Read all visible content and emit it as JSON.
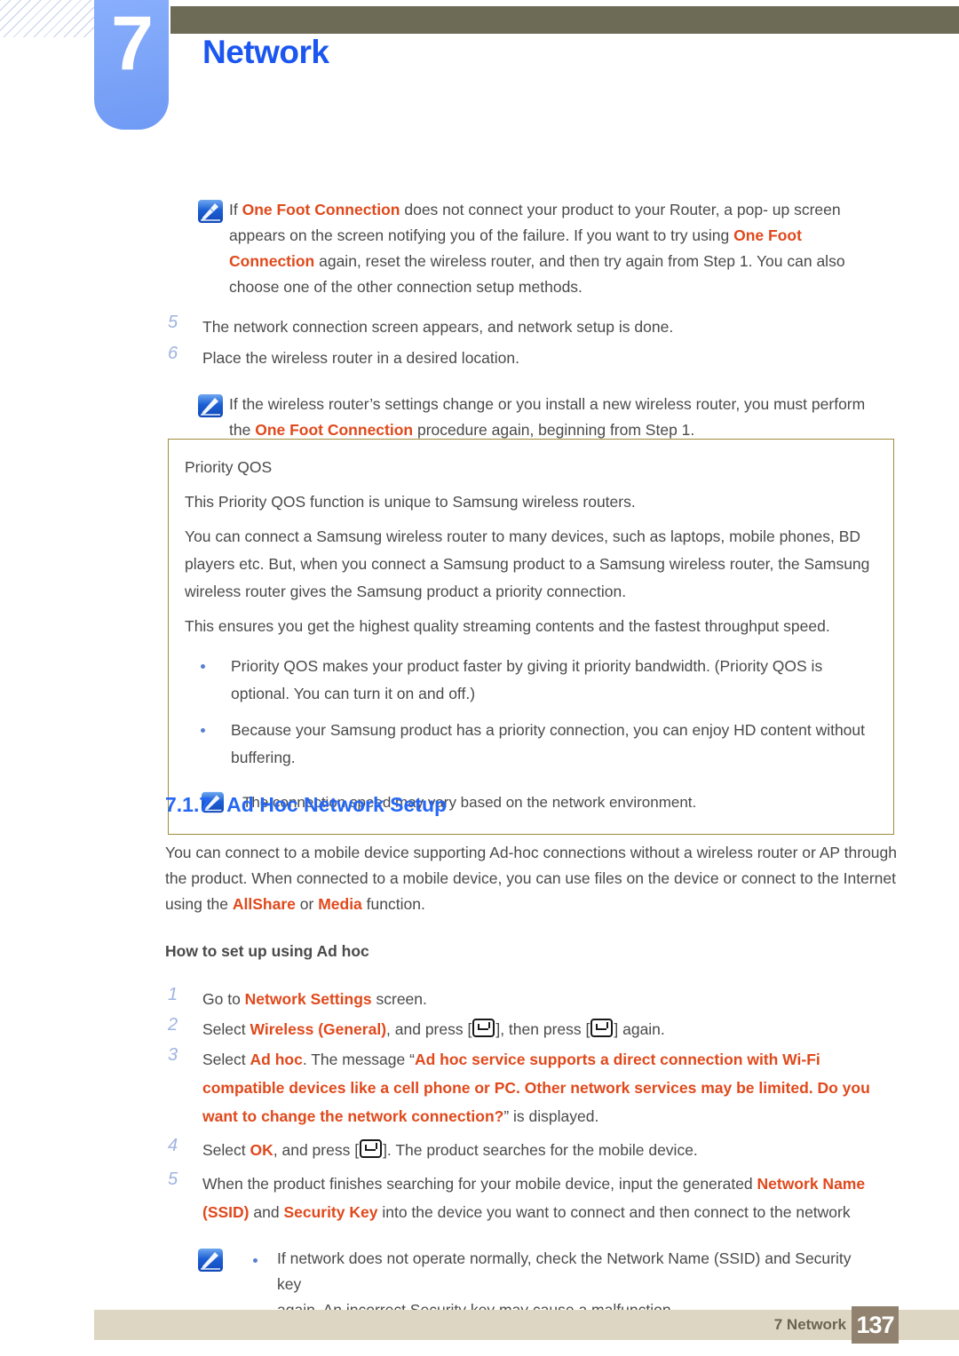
{
  "header": {
    "chapter_number": "7",
    "chapter_title": "Network"
  },
  "notes": {
    "note1": {
      "icon": "note-pencil-icon",
      "text_runs": [
        {
          "t": "If ",
          "style": "normal"
        },
        {
          "t": "One Foot Connection",
          "style": "highlight"
        },
        {
          "t": " does not connect your product to your Router, a pop- up screen appears on the screen notifying you of the failure. If you want to try using ",
          "style": "normal"
        },
        {
          "t": "One Foot Connection",
          "style": "highlight"
        },
        {
          "t": " again, reset the wireless router, and then try again from Step 1. You can also choose one of the other connection setup methods.",
          "style": "normal"
        }
      ]
    },
    "note2": {
      "icon": "note-pencil-icon",
      "text_runs": [
        {
          "t": "If the wireless router’s settings change or you install a new wireless router, you must perform the ",
          "style": "normal"
        },
        {
          "t": "One Foot Connection",
          "style": "highlight"
        },
        {
          "t": " procedure again, beginning from Step 1.",
          "style": "normal"
        }
      ]
    },
    "note3": {
      "icon": "note-pencil-icon",
      "text": "The connection speed may vary based on the network environment."
    },
    "note4": {
      "icon": "note-pencil-icon",
      "bullet_line1": "If network does not operate normally, check the Network Name (SSID) and Security key",
      "bullet_line2": "again. An incorrect Security key may cause a malfunction."
    }
  },
  "steps_top": [
    {
      "num": "5",
      "text": "The network connection screen appears, and network setup is done."
    },
    {
      "num": "6",
      "text": "Place the wireless router in a desired location."
    }
  ],
  "qos_box": {
    "title": "Priority QOS",
    "paragraphs": [
      "This Priority QOS function is unique to Samsung wireless routers.",
      "You can connect a Samsung wireless router to many devices, such as laptops, mobile phones, BD players etc. But, when you connect a Samsung product to a Samsung wireless router, the Samsung wireless router gives the Samsung product a priority connection.",
      "This ensures you get the highest quality streaming contents and the fastest throughput speed."
    ],
    "bullets": [
      "Priority QOS makes your product faster by giving it priority bandwidth. (Priority QOS is optional. You can turn it on and off.)",
      "Because your Samsung product has a priority connection, you can enjoy HD content without buffering."
    ]
  },
  "section": {
    "number": "7.1.7",
    "title": "Ad Hoc Network Setup",
    "intro_runs": [
      {
        "t": "You can connect to a mobile device supporting Ad-hoc connections without a wireless router or AP through the product. When connected to a mobile device, you can use files on the device or connect to the Internet using the ",
        "style": "normal"
      },
      {
        "t": "AllShare",
        "style": "highlight"
      },
      {
        "t": " or ",
        "style": "normal"
      },
      {
        "t": "Media",
        "style": "highlight"
      },
      {
        "t": " function.",
        "style": "normal"
      }
    ],
    "sub_heading": "How to set up using Ad hoc"
  },
  "steps_adhoc": [
    {
      "num": "1",
      "runs": [
        {
          "t": "Go to ",
          "style": "normal"
        },
        {
          "t": "Network Settings",
          "style": "highlight"
        },
        {
          "t": " screen.",
          "style": "normal"
        }
      ]
    },
    {
      "num": "2",
      "runs": [
        {
          "t": "Select ",
          "style": "normal"
        },
        {
          "t": "Wireless (General)",
          "style": "highlight"
        },
        {
          "t": ", and press [",
          "style": "normal"
        },
        {
          "t": "",
          "style": "enterkey"
        },
        {
          "t": "], then press [",
          "style": "normal"
        },
        {
          "t": "",
          "style": "enterkey"
        },
        {
          "t": "] again.",
          "style": "normal"
        }
      ]
    },
    {
      "num": "3",
      "runs": [
        {
          "t": "Select ",
          "style": "normal"
        },
        {
          "t": "Ad hoc",
          "style": "highlight"
        },
        {
          "t": ". The message “",
          "style": "normal"
        },
        {
          "t": "Ad hoc service supports a direct connection with Wi-Fi compatible devices like a cell phone or PC. Other network services may be limited. Do you want to change the network connection?",
          "style": "highlight"
        },
        {
          "t": "” is displayed.",
          "style": "normal"
        }
      ]
    },
    {
      "num": "4",
      "runs": [
        {
          "t": "Select ",
          "style": "normal"
        },
        {
          "t": "OK",
          "style": "highlight"
        },
        {
          "t": ", and press [",
          "style": "normal"
        },
        {
          "t": "",
          "style": "enterkey"
        },
        {
          "t": "]. The product searches for the mobile device.",
          "style": "normal"
        }
      ]
    },
    {
      "num": "5",
      "runs": [
        {
          "t": "When the product finishes searching for your mobile device, input the generated ",
          "style": "normal"
        },
        {
          "t": "Network Name (SSID)",
          "style": "highlight"
        },
        {
          "t": " and ",
          "style": "normal"
        },
        {
          "t": "Security Key",
          "style": "highlight"
        },
        {
          "t": " into the device you want to connect and then connect to the network",
          "style": "normal"
        }
      ]
    }
  ],
  "footer": {
    "label": "7 Network",
    "page_number": "137"
  },
  "colors": {
    "accent_blue": "#2668f5",
    "highlight_orange": "#d3401a",
    "olive_bar": "#6d6a55",
    "tab_blue": "#7ba3f7",
    "box_border": "#a08c3c",
    "footer_bar": "#ddd6c2",
    "footer_page_bg": "#90826f"
  }
}
